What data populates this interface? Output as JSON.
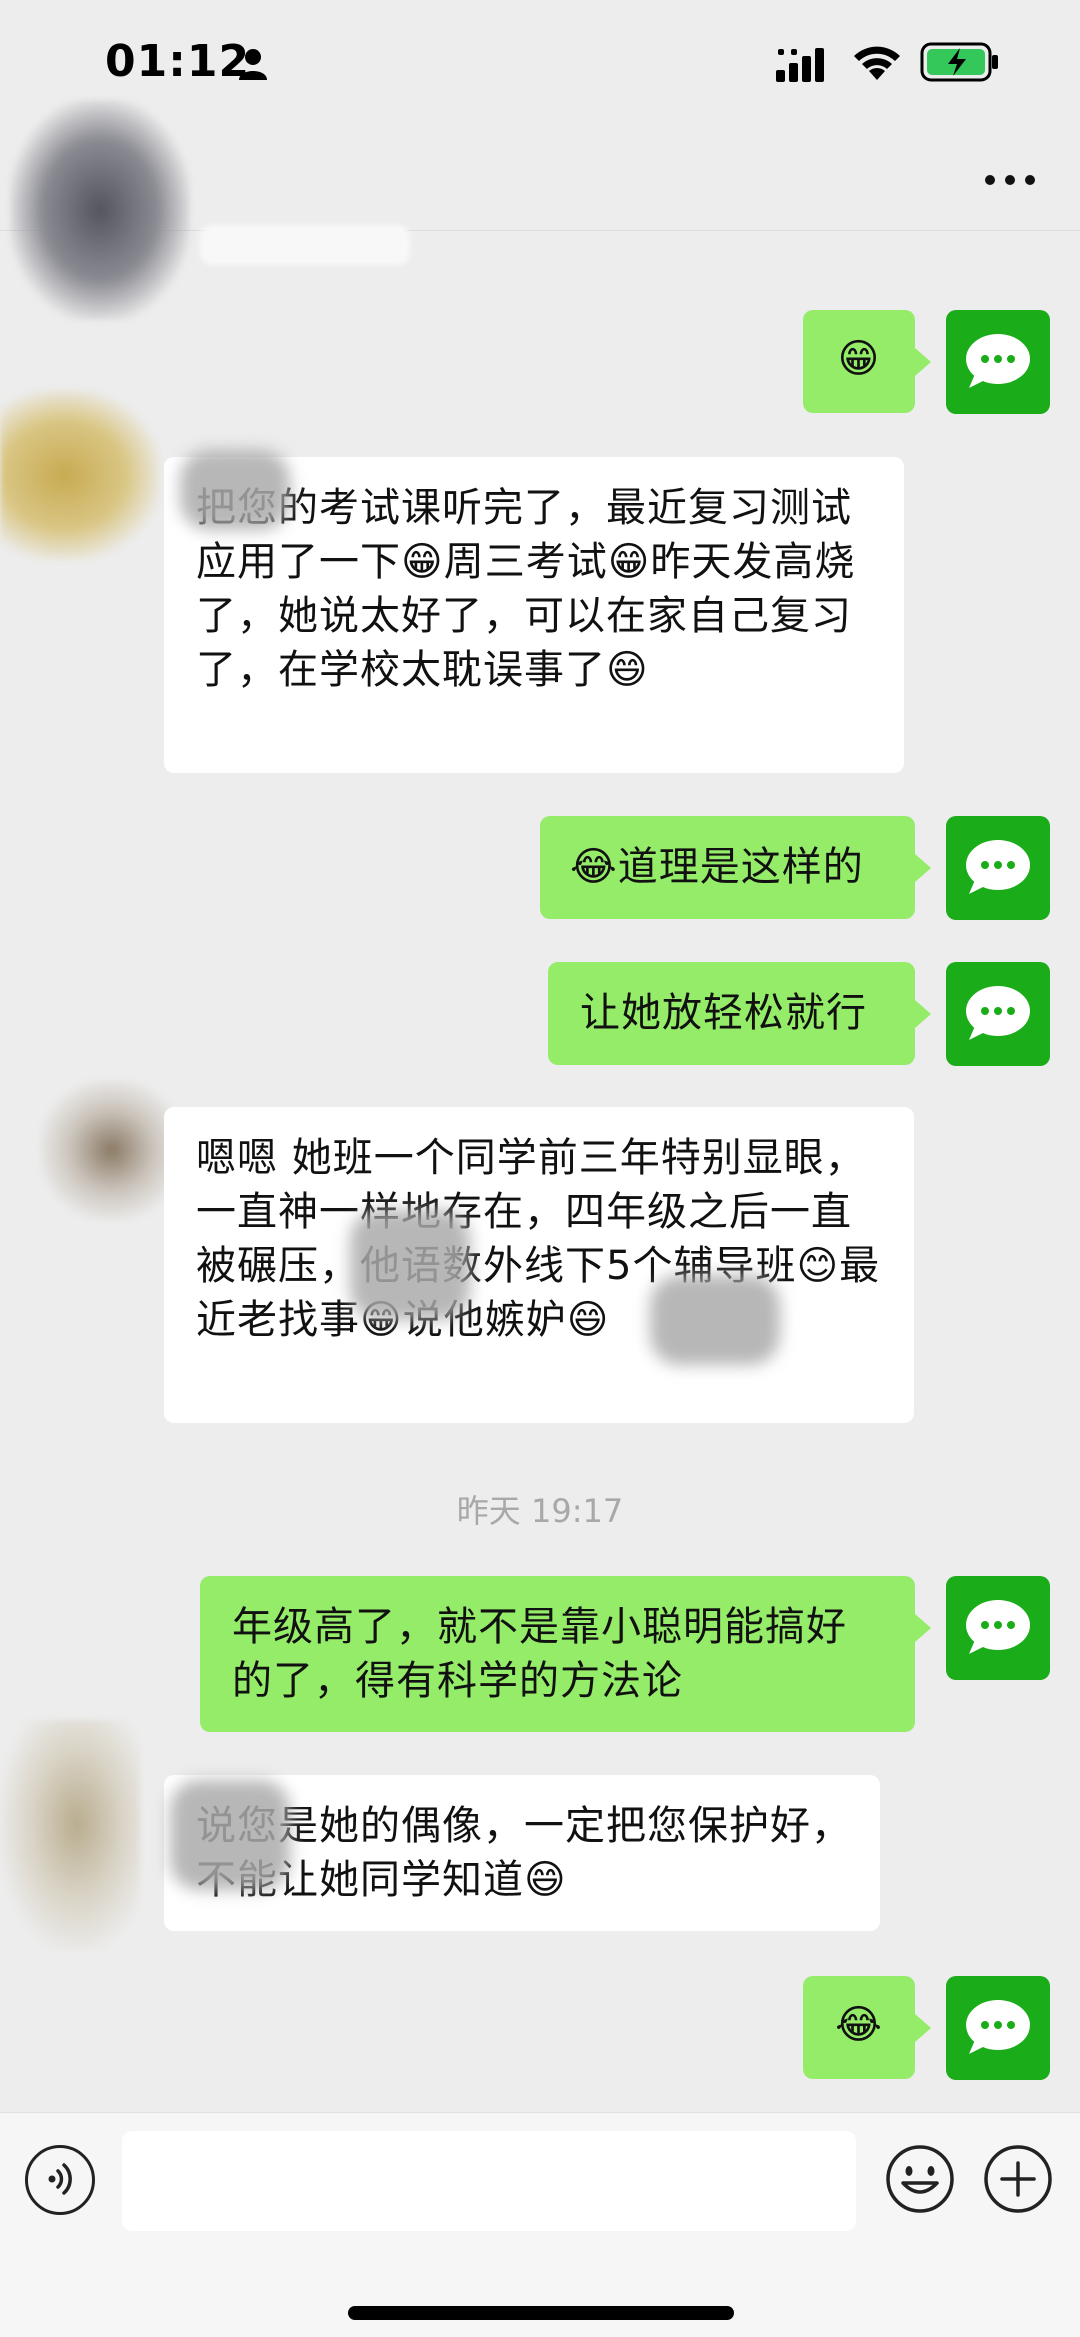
{
  "status_bar": {
    "time": "01:12"
  },
  "nav": {
    "more_icon": "more-dots-icon"
  },
  "messages": [
    {
      "side": "out",
      "text": "😁"
    },
    {
      "side": "in",
      "text": "把您的考试课听完了，最近复习测试应用了一下😁周三考试😁昨天发高烧了，她说太好了，可以在家自己复习了，在学校太耽误事了😄"
    },
    {
      "side": "out",
      "text": "😂道理是这样的"
    },
    {
      "side": "out",
      "text": "让她放轻松就行"
    },
    {
      "side": "in",
      "text": "嗯嗯 她班一个同学前三年特别显眼，一直神一样地存在，四年级之后一直被碾压，他语数外线下5个辅导班😊最近老找事😁说他嫉妒😄"
    },
    {
      "side": "out",
      "text": "年级高了，就不是靠小聪明能搞好的了，得有科学的方法论"
    },
    {
      "side": "in",
      "text": "说您是她的偶像，一定把您保护好，不能让她同学知道😄"
    },
    {
      "side": "out",
      "text": "😂"
    }
  ],
  "timestamp": "昨天 19:17",
  "input_bar": {
    "voice_icon": "voice-icon",
    "emoji_icon": "emoji-icon",
    "plus_icon": "plus-icon"
  },
  "colors": {
    "outgoing_bubble": "#95ec69",
    "incoming_bubble": "#ffffff",
    "self_avatar": "#1aad19",
    "background": "#ededed"
  }
}
